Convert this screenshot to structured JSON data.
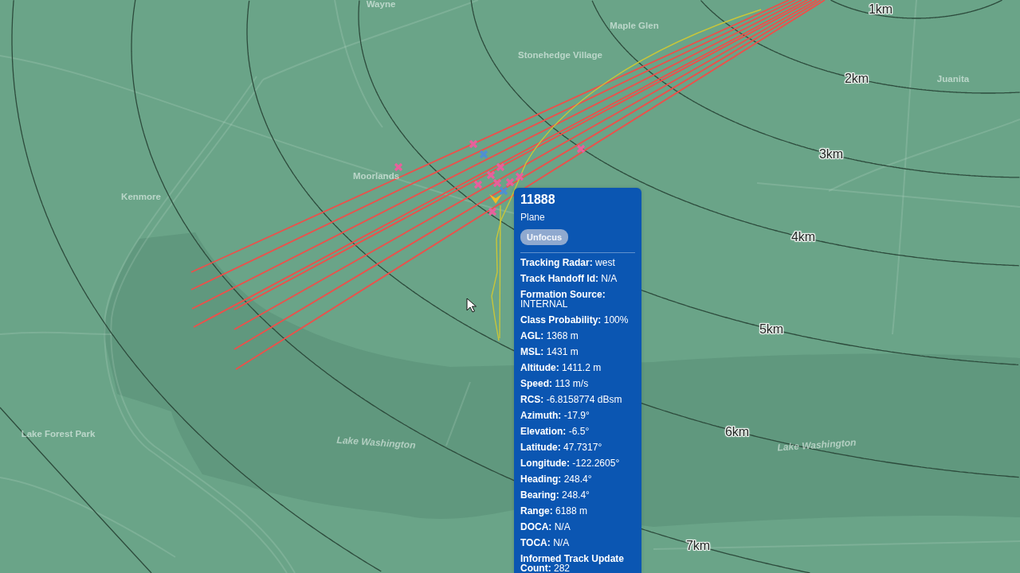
{
  "map": {
    "place_labels": [
      {
        "text": "Wayne",
        "kind": "place"
      },
      {
        "text": "Maple Glen",
        "kind": "place"
      },
      {
        "text": "Stonehedge Village",
        "kind": "place"
      },
      {
        "text": "Juanita",
        "kind": "place"
      },
      {
        "text": "Kenmore",
        "kind": "place"
      },
      {
        "text": "Moorlands",
        "kind": "place"
      },
      {
        "text": "Lake Forest Park",
        "kind": "place"
      },
      {
        "text": "Lake Washington",
        "kind": "water"
      },
      {
        "text": "Lake Washington",
        "kind": "water"
      }
    ],
    "range_rings": [
      {
        "label": "1km"
      },
      {
        "label": "2km"
      },
      {
        "label": "3km"
      },
      {
        "label": "4km"
      },
      {
        "label": "5km"
      },
      {
        "label": "6km"
      },
      {
        "label": "7km"
      }
    ]
  },
  "track_popup": {
    "title": "11888",
    "subtitle": "Plane",
    "button": "Unfocus",
    "fields": [
      {
        "label": "Tracking Radar:",
        "value": "west"
      },
      {
        "label": "Track Handoff Id:",
        "value": "N/A"
      },
      {
        "label": "Formation Source:",
        "value": "INTERNAL"
      },
      {
        "label": "Class Probability:",
        "value": "100%"
      },
      {
        "label": "AGL:",
        "value": "1368 m"
      },
      {
        "label": "MSL:",
        "value": "1431 m"
      },
      {
        "label": "Altitude:",
        "value": "1411.2 m"
      },
      {
        "label": "Speed:",
        "value": "113 m/s"
      },
      {
        "label": "RCS:",
        "value": "-6.8158774 dBsm"
      },
      {
        "label": "Azimuth:",
        "value": "-17.9°"
      },
      {
        "label": "Elevation:",
        "value": "-6.5°"
      },
      {
        "label": "Latitude:",
        "value": "47.7317°"
      },
      {
        "label": "Longitude:",
        "value": "-122.2605°"
      },
      {
        "label": "Heading:",
        "value": "248.4°"
      },
      {
        "label": "Bearing:",
        "value": "248.4°"
      },
      {
        "label": "Range:",
        "value": "6188 m"
      },
      {
        "label": "DOCA:",
        "value": "N/A"
      },
      {
        "label": "TOCA:",
        "value": "N/A"
      },
      {
        "label": "Informed Track Update Count:",
        "value": "282"
      }
    ]
  }
}
